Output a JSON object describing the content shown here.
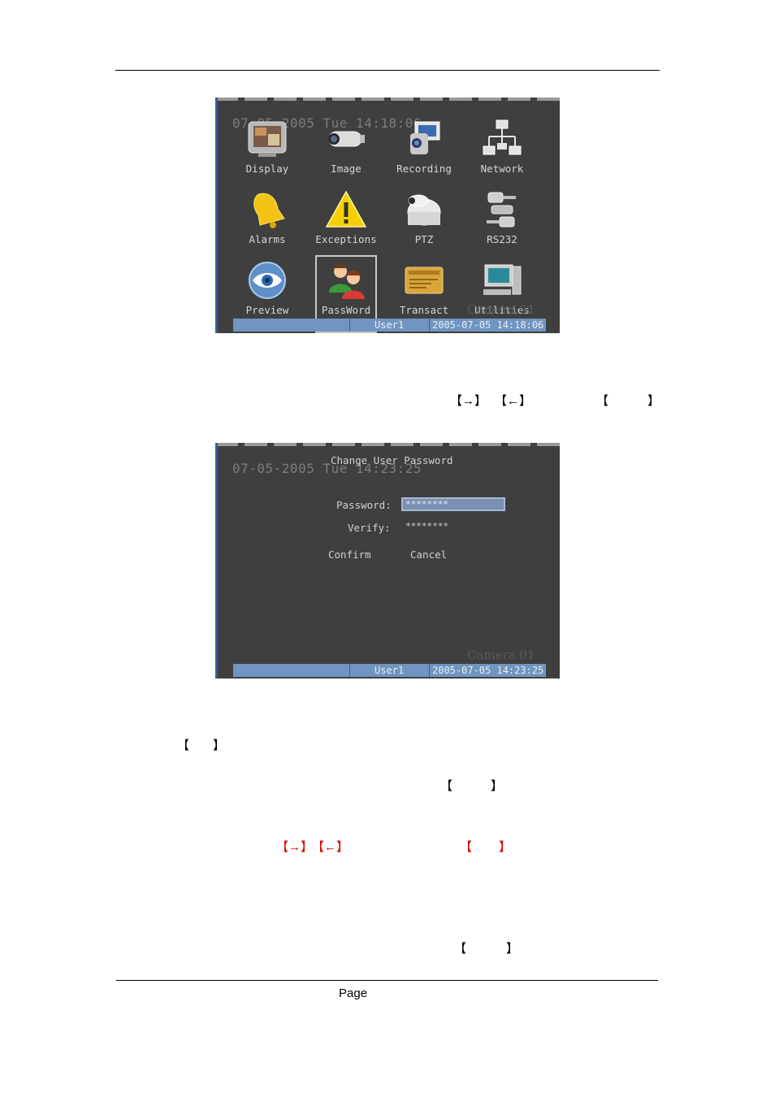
{
  "menu_screen": {
    "datetime": "07-05-2005 Tue 14:18:06",
    "items": [
      {
        "label": "Display",
        "icon": "monitor-icon"
      },
      {
        "label": "Image",
        "icon": "camera-icon"
      },
      {
        "label": "Recording",
        "icon": "camcorder-icon"
      },
      {
        "label": "Network",
        "icon": "network-icon"
      },
      {
        "label": "Alarms",
        "icon": "bell-icon"
      },
      {
        "label": "Exceptions",
        "icon": "warning-icon"
      },
      {
        "label": "PTZ",
        "icon": "ptz-camera-icon"
      },
      {
        "label": "RS232",
        "icon": "serial-connector-icon"
      },
      {
        "label": "Preview",
        "icon": "eye-icon"
      },
      {
        "label": "PassWord",
        "icon": "users-icon",
        "selected": true
      },
      {
        "label": "Transact",
        "icon": "card-icon"
      },
      {
        "label": "Utilities",
        "icon": "computer-icon"
      }
    ],
    "watermark": "Camera 01",
    "status": {
      "user": "User1",
      "datetime": "2005-07-05 14:18:06"
    }
  },
  "password_screen": {
    "datetime": "07-05-2005 Tue 14:23:25",
    "title": "Change User Password",
    "password_label": "Password:",
    "password_value": "********",
    "verify_label": "Verify:",
    "verify_value": "********",
    "confirm_label": "Confirm",
    "cancel_label": "Cancel",
    "watermark": "Camera 01",
    "status": {
      "user": "User1",
      "datetime": "2005-07-05 14:23:25"
    }
  },
  "text": {
    "key_right": "【→】",
    "key_left": "【←】",
    "bracket_open": "【",
    "bracket_close": "】",
    "page_label": "Page"
  },
  "colors": {
    "accent_red": "#e00000",
    "status_bar": "#6f95c0",
    "screen_bg": "#3f3f3f"
  }
}
